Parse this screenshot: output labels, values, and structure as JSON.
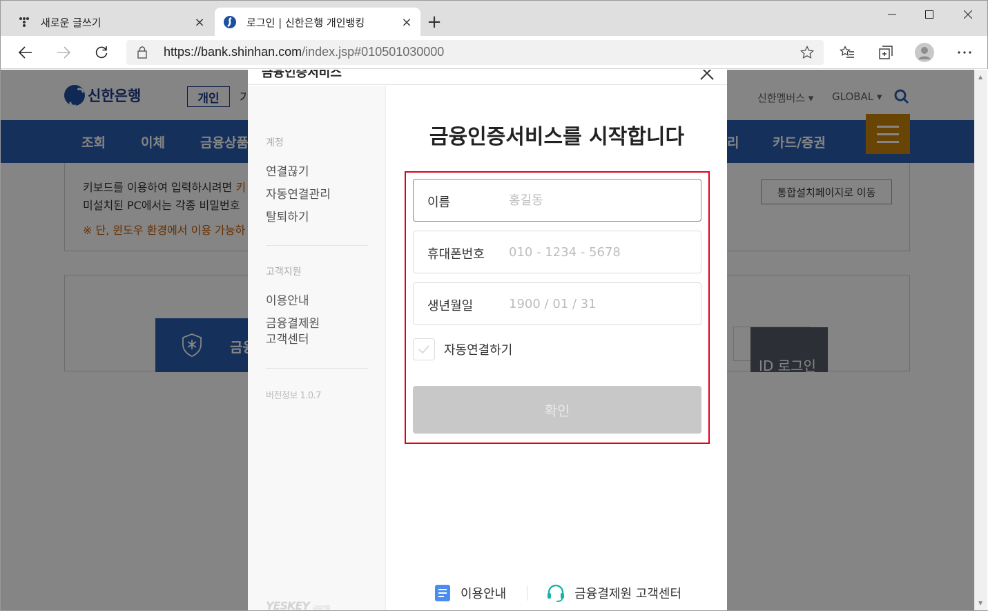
{
  "browser": {
    "tabs": [
      {
        "title": "새로운 글쓰기",
        "icon": "dots-icon",
        "active": false
      },
      {
        "title": "로그인 | 신한은행 개인뱅킹",
        "icon": "shinhan-icon",
        "active": true
      }
    ],
    "close_symbol": "×",
    "new_tab_symbol": "+",
    "url_host": "https://bank.shinhan.com",
    "url_path": "/index.jsp#010501030000"
  },
  "site": {
    "logo_text": "신한은행",
    "segment_active": "개인",
    "segment_next": "기",
    "header_links": [
      "신한멤버스",
      "GLOBAL"
    ],
    "gnb": [
      "조회",
      "이체",
      "금융상품",
      "리",
      "카드/증권"
    ],
    "notice": {
      "line1": "키보드를 이용하여 입력하시려면 ",
      "line1_accent": "키",
      "line2": "미설치된 PC에서는 각종 비밀번호",
      "line3": "※ 단, 윈도우 환경에서 이용 가능하"
    },
    "install_button": "통합설치페이지로 이동",
    "cert_login_label": "금융",
    "id_login_label": "ID 로그인"
  },
  "modal": {
    "header_title": "금융인증서비스",
    "sidebar": {
      "account_caption": "계정",
      "account_items": [
        "연결끊기",
        "자동연결관리",
        "탈퇴하기"
      ],
      "support_caption": "고객지원",
      "support_items": [
        "이용안내",
        "금융결제원\n고객센터"
      ],
      "version": "버전정보 1.0.7",
      "brand": "YESKEY",
      "brand_sub": "금융인증"
    },
    "title": "금융인증서비스를 시작합니다",
    "fields": {
      "name": {
        "label": "이름",
        "placeholder": "홍길동",
        "value": ""
      },
      "phone": {
        "label": "휴대폰번호",
        "placeholder": "010 - 1234 - 5678",
        "value": ""
      },
      "birth": {
        "label": "생년월일",
        "placeholder": "1900 / 01 / 31",
        "value": ""
      }
    },
    "auto_connect_label": "자동연결하기",
    "confirm_label": "확인",
    "footer": {
      "guide": "이용안내",
      "support": "금융결제원 고객센터"
    }
  },
  "colors": {
    "highlight": "#e0001b",
    "brand_blue": "#2a5fae",
    "menu_orange": "#c8820a"
  }
}
